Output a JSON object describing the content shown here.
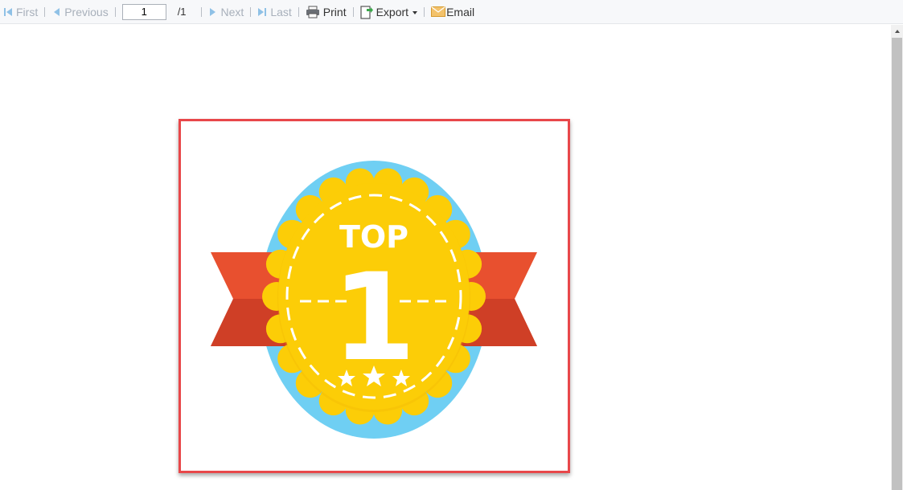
{
  "toolbar": {
    "first_label": "First",
    "previous_label": "Previous",
    "page_value": "1",
    "page_total": "/1",
    "next_label": "Next",
    "last_label": "Last",
    "print_label": "Print",
    "export_label": "Export",
    "email_label": "Email"
  },
  "icons": {
    "first": "first-page-icon",
    "previous": "previous-page-icon",
    "next": "next-page-icon",
    "last": "last-page-icon",
    "print": "printer-icon",
    "export": "export-icon",
    "email": "envelope-icon"
  },
  "badge": {
    "top_text": "TOP",
    "number_text": "1"
  },
  "colors": {
    "frame_border": "#e8474a",
    "badge_blue": "#6fcff3",
    "badge_gold": "#fccd07",
    "ribbon_red": "#e8502f",
    "disabled_text": "#a8b0bb"
  }
}
